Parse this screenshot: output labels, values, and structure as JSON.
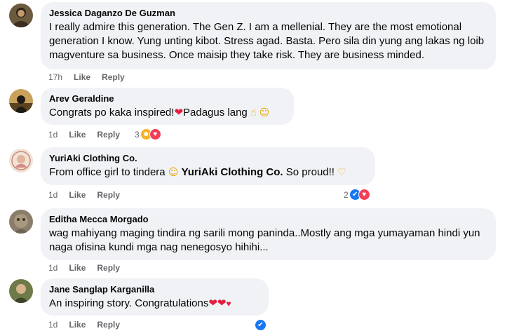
{
  "comments": [
    {
      "author": "Jessica Daganzo De Guzman",
      "text": "I really admire this generation. The Gen Z. I am a mellenial. They are the most emotional generation I know. Yung unting kibot. Stress agad. Basta. Pero sila din yung ang lakas ng loib magventure sa business. Once maisip they take risk. They are business minded.",
      "time": "17h",
      "like": "Like",
      "reply": "Reply"
    },
    {
      "author": "Arev Geraldine",
      "text": "Congrats po kaka inspired!",
      "text_after": "Padagus lang",
      "time": "1d",
      "like": "Like",
      "reply": "Reply",
      "reaction_count": "3"
    },
    {
      "author": "YuriAki Clothing Co.",
      "text": "From office girl to tindera",
      "tag": "YuriAki Clothing Co.",
      "text_after": "So proud!!",
      "time": "1d",
      "like": "Like",
      "reply": "Reply",
      "reaction_count": "2"
    },
    {
      "author": "Editha Mecca Morgado",
      "text": "wag mahiyang maging tindira ng sarili mong paninda..Mostly ang mga yumayaman hindi yun naga ofisina kundi mga nag nenegosyo hihihi...",
      "time": "1d",
      "like": "Like",
      "reply": "Reply"
    },
    {
      "author": "Jane Sanglap Karganilla",
      "text": "An inspiring story. Congratulations",
      "time": "1d",
      "like": "Like",
      "reply": "Reply"
    }
  ],
  "colors": {
    "bubble": "#f0f2f5",
    "muted": "#65676b",
    "like_blue": "#1877f2",
    "love_red": "#f33e58"
  }
}
